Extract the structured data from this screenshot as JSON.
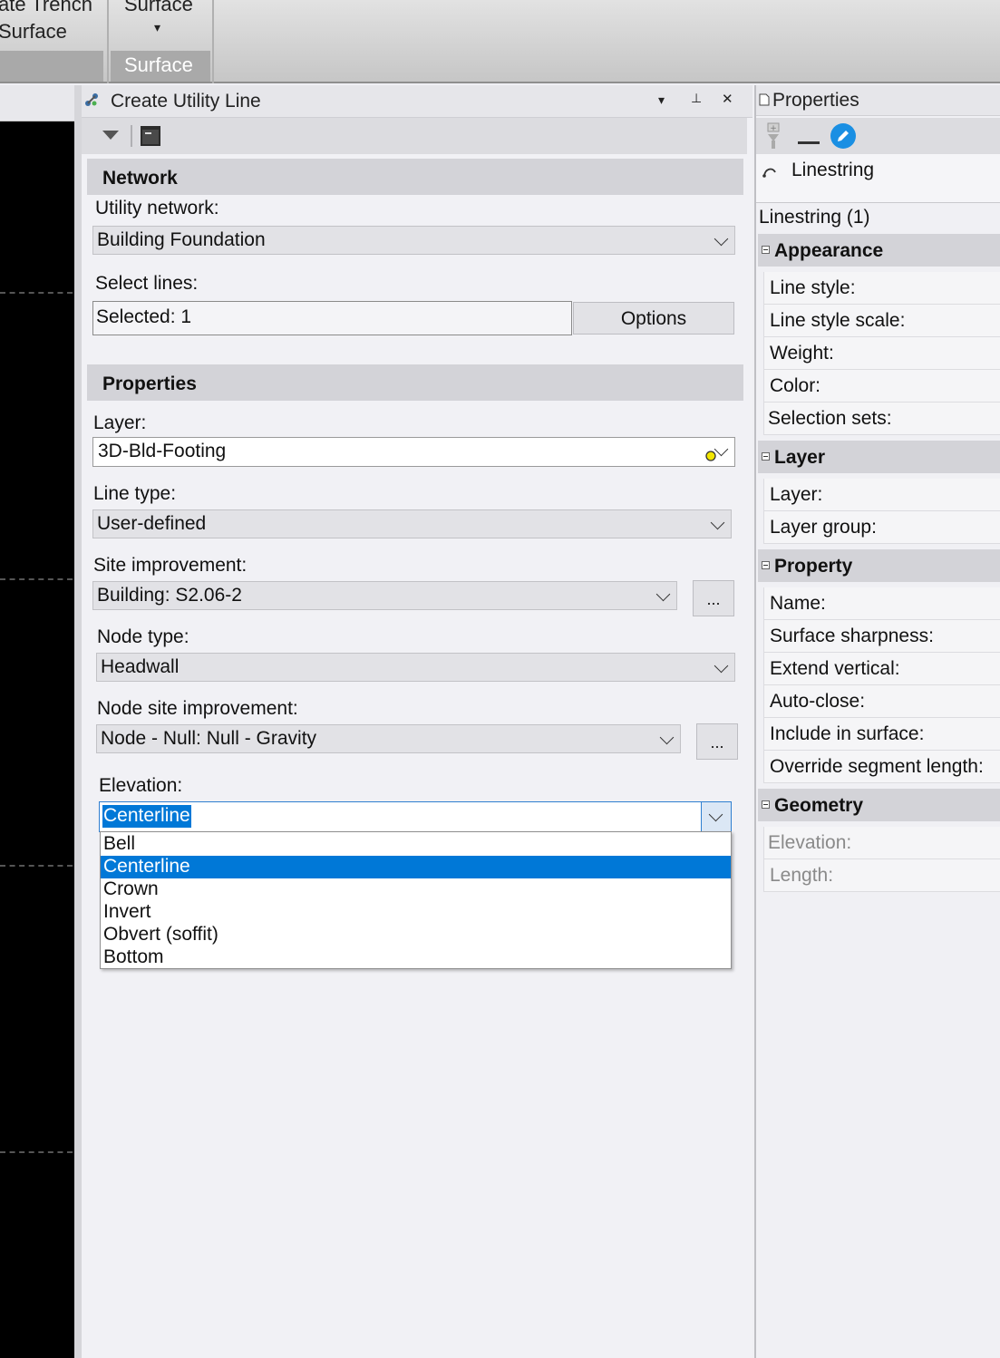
{
  "ribbon": {
    "group1_line1": "ate Trench",
    "group1_line2": "Surface",
    "group2_line1": "Surface",
    "group2_arrow": "▾",
    "group2_label": "Surface"
  },
  "panel": {
    "title": "Create Utility Line",
    "menu_glyph": "▾",
    "pin_glyph": "⊥",
    "close_glyph": "✕",
    "network_header": "Network",
    "utility_network_label": "Utility network:",
    "utility_network_value": "Building Foundation",
    "select_lines_label": "Select lines:",
    "selected_value": "Selected: 1",
    "options_label": "Options",
    "properties_header": "Properties",
    "layer_label": "Layer:",
    "layer_value": "3D-Bld-Footing",
    "line_type_label": "Line type:",
    "line_type_value": "User-defined",
    "site_improvement_label": "Site improvement:",
    "site_improvement_value": "Building: S2.06-2",
    "node_type_label": "Node type:",
    "node_type_value": "Headwall",
    "node_site_improvement_label": "Node site improvement:",
    "node_site_improvement_value": "Node - Null: Null - Gravity",
    "ellipsis": "...",
    "elevation_label": "Elevation:",
    "elevation_value": "Centerline",
    "elevation_options": [
      "Bell",
      "Centerline",
      "Crown",
      "Invert",
      "Obvert (soffit)",
      "Bottom"
    ],
    "elevation_selected_index": 1
  },
  "properties": {
    "title": "Properties",
    "object_type": "Linestring",
    "selection_count": "Linestring (1)",
    "groups": {
      "appearance": "Appearance",
      "layer": "Layer",
      "property": "Property",
      "geometry": "Geometry"
    },
    "appearance_rows": [
      "Line style:",
      "Line style scale:",
      "Weight:",
      "Color:",
      "Selection sets:"
    ],
    "layer_rows": [
      "Layer:",
      "Layer group:"
    ],
    "property_rows": [
      "Name:",
      "Surface sharpness:",
      "Extend vertical:",
      "Auto-close:",
      "Include in surface:",
      "Override segment length:"
    ],
    "geometry_rows": [
      "Elevation:",
      "Length:"
    ]
  },
  "colors": {
    "selection_blue": "#0078d7",
    "edit_icon_blue": "#1a8fe3",
    "canvas_black": "#000000"
  }
}
